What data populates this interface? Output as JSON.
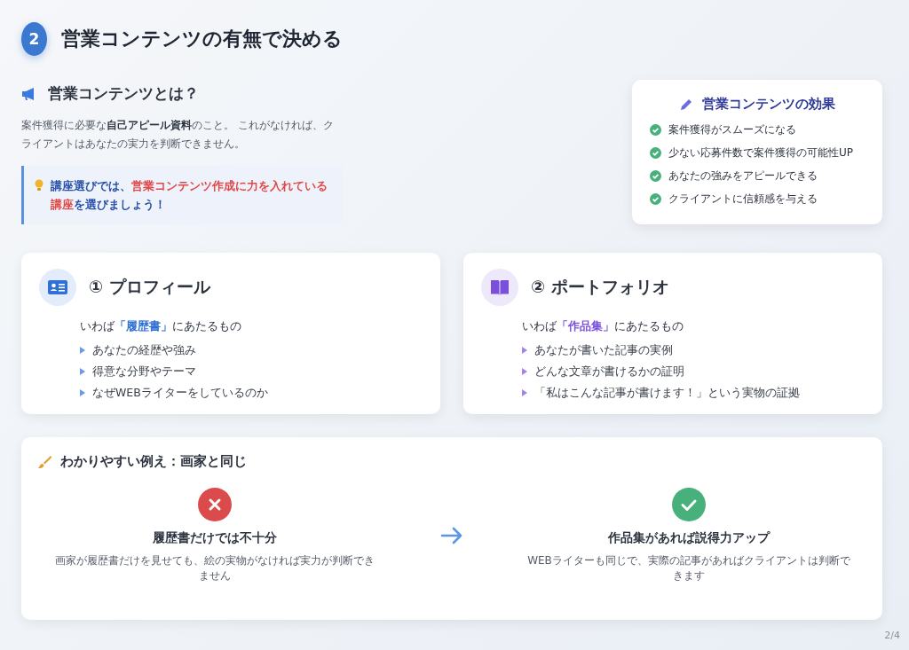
{
  "header": {
    "number": "2",
    "title": "営業コンテンツの有無で決める"
  },
  "intro": {
    "heading": "営業コンテンツとは？",
    "description": "案件獲得に必要な**自己アピール資料**のこと。 これがなければ、クライアントはあなたの実力を判断できません。",
    "tip": [
      {
        "text": "講座選びでは、",
        "highlight": false
      },
      {
        "text": "営業コンテンツ作成に力を入れている講座",
        "highlight": true
      },
      {
        "text": "を選びましょう！",
        "highlight": false
      }
    ]
  },
  "effects": {
    "title": "営業コンテンツの効果",
    "items": [
      "案件獲得がスムーズになる",
      "少ない応募件数で案件獲得の可能性UP",
      "あなたの強みをアピールできる",
      "クライアントに信頼感を与える"
    ]
  },
  "cards": [
    {
      "kind": "profile",
      "title": "① プロフィール",
      "color": "#2f6fd6",
      "lead_prefix": "いわば",
      "term": "「履歴書」",
      "lead_suffix": "にあたるもの",
      "points": [
        "あなたの経歴や強み",
        "得意な分野やテーマ",
        "なぜWEBライターをしているのか"
      ]
    },
    {
      "kind": "portfolio",
      "title": "② ポートフォリオ",
      "color": "#7a4fdb",
      "lead_prefix": "いわば",
      "term": "「作品集」",
      "lead_suffix": "にあたるもの",
      "points": [
        "あなたが書いた記事の実例",
        "どんな文章が書けるかの証明",
        "「私はこんな記事が書けます！」という実物の証拠"
      ]
    }
  ],
  "example": {
    "title": "わかりやすい例え：画家と同じ",
    "cases": [
      {
        "kind": "bad",
        "heading": "履歴書だけでは不十分",
        "text": "画家が履歴書だけを見せても、絵の実物がなければ実力が判断できません"
      },
      {
        "kind": "good",
        "heading": "作品集があれば説得力アップ",
        "text": "WEBライターも同じで、実際の記事があればクライアントは判断できます"
      }
    ]
  },
  "page_number": "2/4"
}
